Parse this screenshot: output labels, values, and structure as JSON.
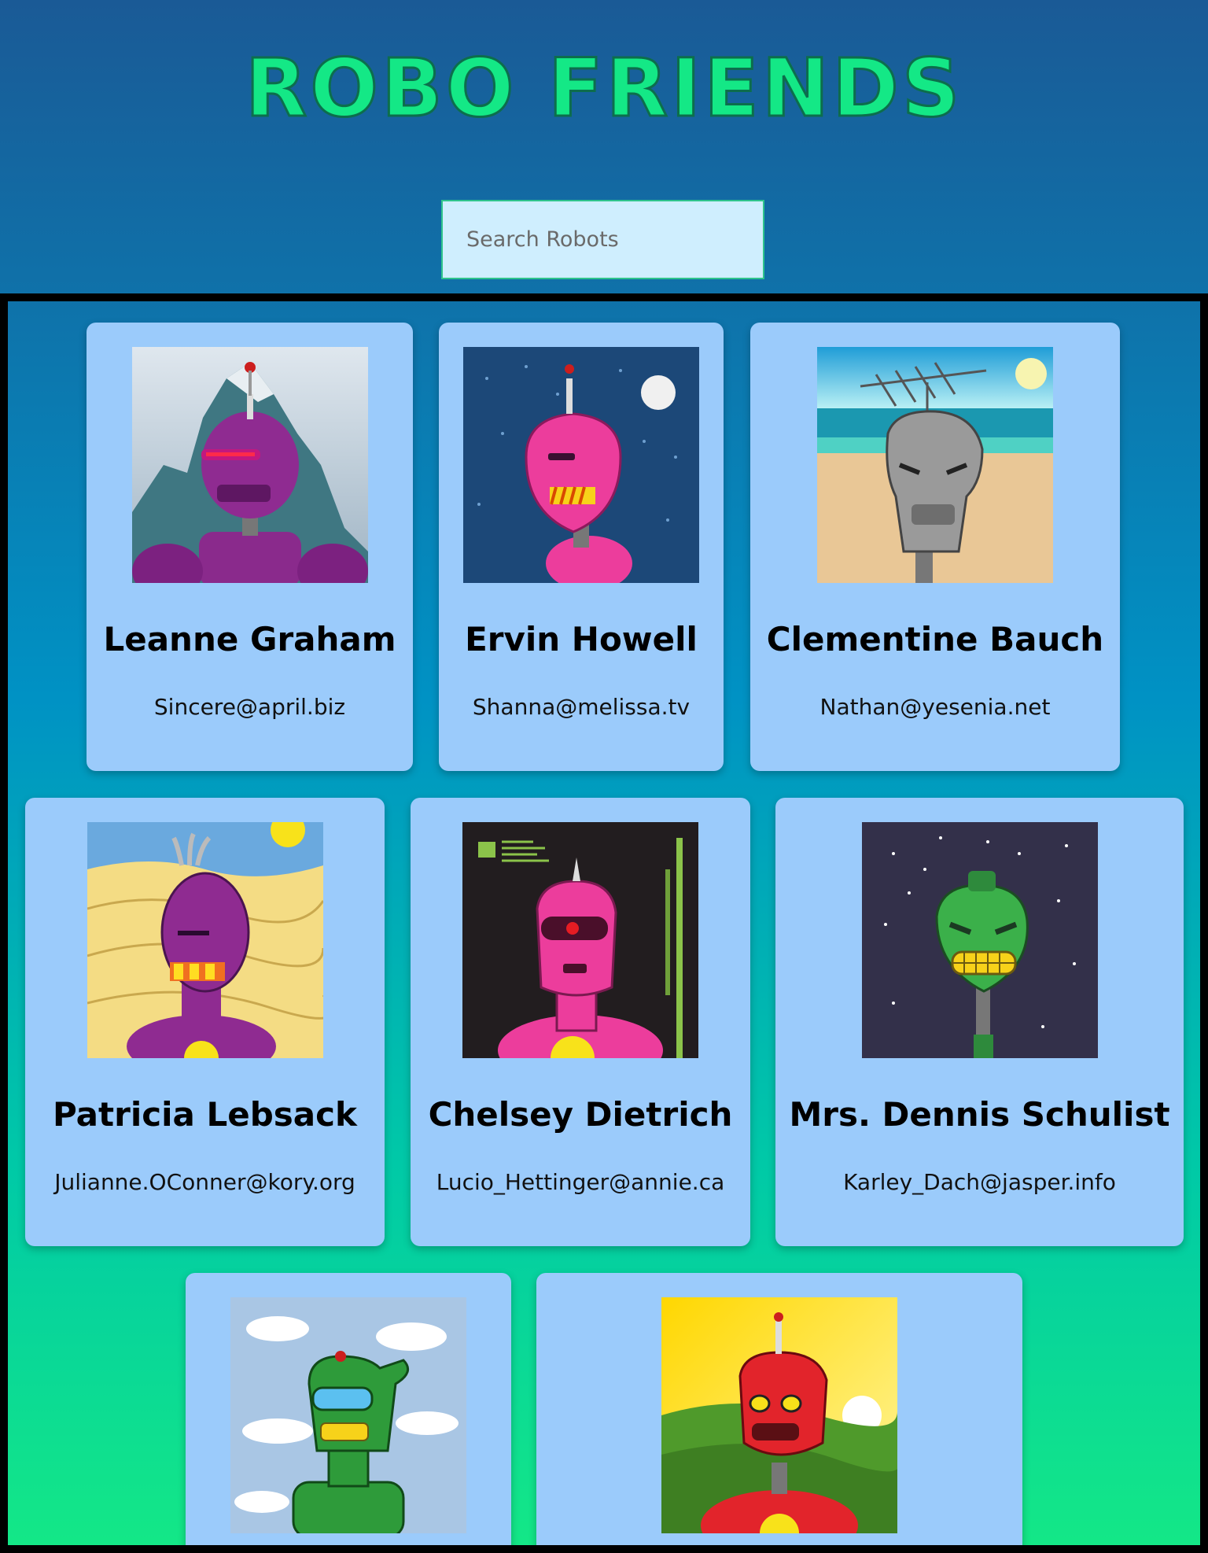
{
  "header": {
    "title": "ROBO FRIENDS"
  },
  "search": {
    "placeholder": "Search Robots",
    "value": ""
  },
  "robots": [
    {
      "name": "Leanne Graham",
      "email": "Sincere@april.biz",
      "avatar": "purple-robot-mountain"
    },
    {
      "name": "Ervin Howell",
      "email": "Shanna@melissa.tv",
      "avatar": "pink-robot-night-sky"
    },
    {
      "name": "Clementine Bauch",
      "email": "Nathan@yesenia.net",
      "avatar": "grey-robot-beach"
    },
    {
      "name": "Patricia Lebsack",
      "email": "Julianne.OConner@kory.org",
      "avatar": "purple-robot-desert"
    },
    {
      "name": "Chelsey Dietrich",
      "email": "Lucio_Hettinger@annie.ca",
      "avatar": "pink-robot-dark-screen"
    },
    {
      "name": "Mrs. Dennis Schulist",
      "email": "Karley_Dach@jasper.info",
      "avatar": "green-robot-starfield"
    },
    {
      "name": "",
      "email": "",
      "avatar": "green-robot-clouds"
    },
    {
      "name": "",
      "email": "",
      "avatar": "red-robot-hills"
    }
  ]
}
